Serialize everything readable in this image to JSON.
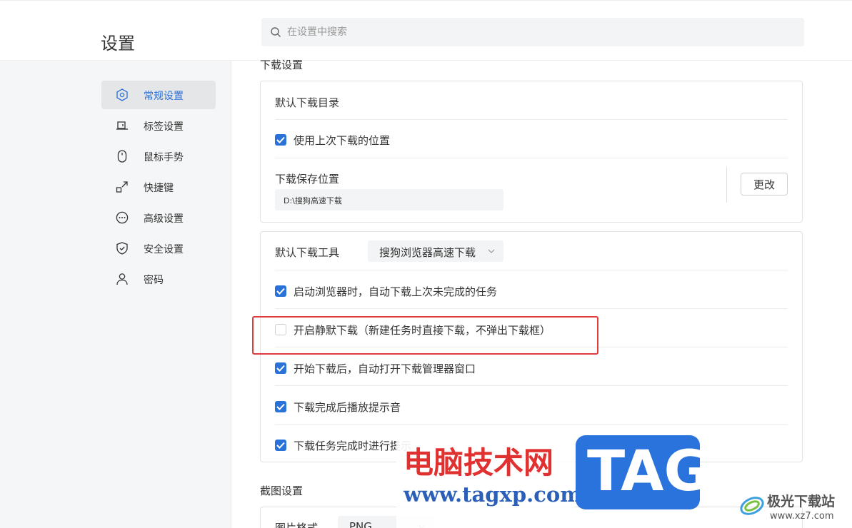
{
  "page": {
    "title": "设置"
  },
  "search": {
    "placeholder": "在设置中搜索"
  },
  "sidebar": {
    "items": [
      {
        "label": "常规设置",
        "icon": "general-settings-icon",
        "active": true
      },
      {
        "label": "标签设置",
        "icon": "tab-settings-icon"
      },
      {
        "label": "鼠标手势",
        "icon": "mouse-icon"
      },
      {
        "label": "快捷键",
        "icon": "shortcut-icon"
      },
      {
        "label": "高级设置",
        "icon": "more-icon"
      },
      {
        "label": "安全设置",
        "icon": "shield-icon"
      },
      {
        "label": "密码",
        "icon": "user-icon"
      }
    ]
  },
  "download": {
    "section_title": "下载设置",
    "default_dir_label": "默认下载目录",
    "use_last_location": {
      "label": "使用上次下载的位置",
      "checked": true
    },
    "save_location_label": "下载保存位置",
    "save_path": "D:\\搜狗高速下载",
    "change_button": "更改",
    "default_tool_label": "默认下载工具",
    "default_tool_value": "搜狗浏览器高速下载",
    "options": [
      {
        "label": "启动浏览器时，自动下载上次未完成的任务",
        "checked": true
      },
      {
        "label": "开启静默下载（新建任务时直接下载，不弹出下载框）",
        "checked": false
      },
      {
        "label": "开始下载后，自动打开下载管理器窗口",
        "checked": true
      },
      {
        "label": "下载完成后播放提示音",
        "checked": true
      },
      {
        "label": "下载任务完成时进行提示",
        "checked": true
      }
    ]
  },
  "screenshot": {
    "section_title": "截图设置",
    "image_format_label": "图片格式",
    "image_format_value": "PNG"
  },
  "watermark": {
    "site_cn": "电脑技术网",
    "site_url": "www.tagxp.com",
    "tag": "TAG",
    "brand2_cn": "极光下载站",
    "brand2_url": "www.xz7.com"
  },
  "colors": {
    "accent": "#2b72d8",
    "highlight_box": "#e03a3a"
  }
}
